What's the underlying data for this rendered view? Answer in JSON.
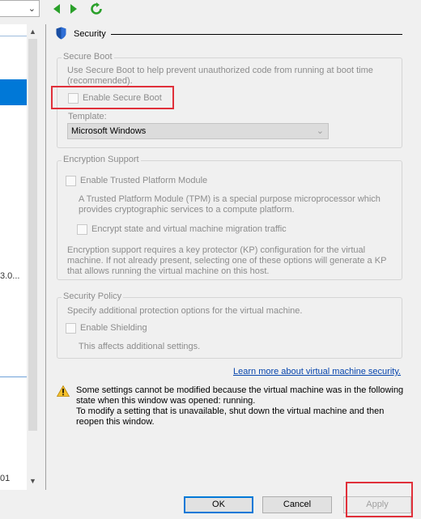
{
  "left_pane": {
    "truncated_text_1": "3.0...",
    "truncated_text_2": "01"
  },
  "section": {
    "title": "Security",
    "icon": "shield-icon"
  },
  "secure_boot": {
    "group_label": "Secure Boot",
    "description": "Use Secure Boot to help prevent unauthorized code from running at boot time (recommended).",
    "checkbox_label": "Enable Secure Boot",
    "checked": false,
    "template_label": "Template:",
    "template_value": "Microsoft Windows"
  },
  "encryption": {
    "group_label": "Encryption Support",
    "tpm_label": "Enable Trusted Platform Module",
    "tpm_description": "A Trusted Platform Module (TPM) is a special purpose microprocessor which provides cryptographic services to a compute platform.",
    "encrypt_label": "Encrypt state and virtual machine migration traffic",
    "note": "Encryption support requires a key protector (KP) configuration for the virtual machine. If not already present, selecting one of these options will generate a KP that allows running the virtual machine on this host."
  },
  "security_policy": {
    "group_label": "Security Policy",
    "description": "Specify additional protection options for the virtual machine.",
    "shielding_label": "Enable Shielding",
    "shielding_note": "This affects additional settings."
  },
  "learn_more_link": "Learn more about virtual machine security.",
  "warning": {
    "line1": "Some settings cannot be modified because the virtual machine was in the following state when this window was opened: running.",
    "line2": "To modify a setting that is unavailable, shut down the virtual machine and then reopen this window."
  },
  "buttons": {
    "ok": "OK",
    "cancel": "Cancel",
    "apply": "Apply"
  },
  "colors": {
    "accent": "#0078d7",
    "highlight_box": "#e0303a",
    "disabled_text": "#8c8c8c"
  }
}
